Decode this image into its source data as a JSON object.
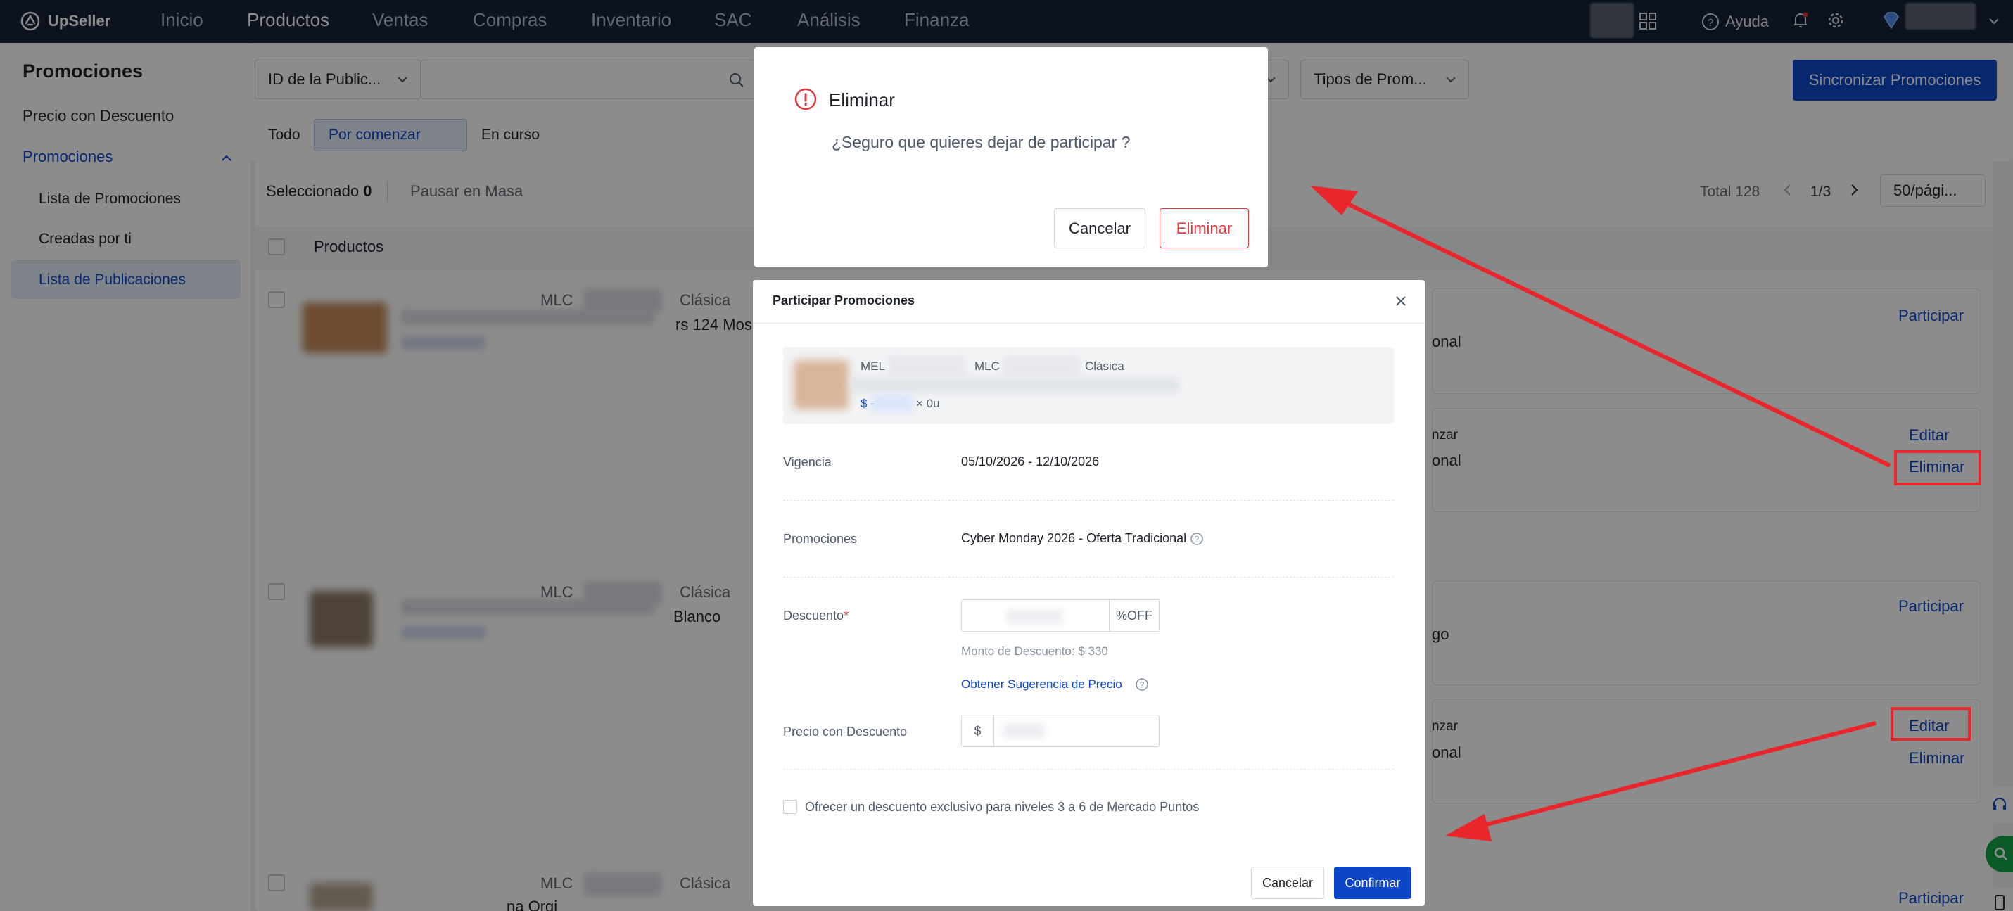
{
  "app": {
    "name": "UpSeller"
  },
  "topnav": {
    "items": [
      "Inicio",
      "Productos",
      "Ventas",
      "Compras",
      "Inventario",
      "SAC",
      "Análisis",
      "Finanza"
    ],
    "active": "Productos",
    "help_label": "Ayuda"
  },
  "sidebar": {
    "title": "Promociones",
    "items": {
      "precio_descuento": "Precio con Descuento",
      "promociones": "Promociones",
      "lista_promociones": "Lista de Promociones",
      "creadas": "Creadas por ti",
      "lista_publicaciones": "Lista de Publicaciones"
    }
  },
  "filters": {
    "id_select": "ID de la Public...",
    "tipos_select": "Tipos de Prom...",
    "sync_button": "Sincronizar Promociones",
    "status_tabs": [
      "Todo",
      "Por comenzar",
      "En curso"
    ]
  },
  "toolbar": {
    "selected_label": "Seleccionado",
    "selected_count": "0",
    "pause_label": "Pausar en Masa",
    "total_label": "Total 128",
    "page": "1/3",
    "page_size": "50/pági..."
  },
  "table": {
    "header_products": "Productos",
    "rows": [
      {
        "mlc": "MLC",
        "type": "Clásica",
        "title_fragment": "rs 124 Mos"
      },
      {
        "mlc": "MLC",
        "type": "Clásica",
        "title_fragment": "Blanco"
      },
      {
        "mlc": "MLC",
        "type": "Clásica",
        "title_fragment": "na Orgi"
      }
    ],
    "fragments": {
      "onal1": "onal",
      "nzar1": "nzar",
      "onal2": "onal",
      "go": "go",
      "nzar2": "nzar",
      "onal3": "onal"
    },
    "actions": {
      "participar": "Participar",
      "editar": "Editar",
      "eliminar": "Eliminar"
    }
  },
  "confirm_dialog": {
    "title": "Eliminar",
    "message": "¿Seguro que quieres dejar de participar ?",
    "cancel": "Cancelar",
    "confirm": "Eliminar"
  },
  "participar_modal": {
    "title": "Participar Promociones",
    "product": {
      "tag1": "MEL",
      "tag2": "MLC",
      "tag3": "Clásica",
      "price_prefix": "$ -",
      "qty": "× 0u"
    },
    "vigencia_label": "Vigencia",
    "vigencia_value": "05/10/2026 - 12/10/2026",
    "promociones_label": "Promociones",
    "promociones_value": "Cyber Monday 2026 - Oferta Tradicional",
    "descuento_label": "Descuento",
    "descuento_suffix": "%OFF",
    "monto": "Monto de Descuento: $ 330",
    "sugerencia": "Obtener Sugerencia de Precio",
    "precio_label": "Precio con Descuento",
    "precio_prefix": "$",
    "checkbox_label": "Ofrecer un descuento exclusivo para niveles 3 a 6 de Mercado Puntos",
    "cancel": "Cancelar",
    "confirm": "Confirmar"
  },
  "colors": {
    "accent": "#0d47c8",
    "danger": "#e0383e",
    "nav_bg": "#16233a",
    "annotation": "#e8262b"
  }
}
